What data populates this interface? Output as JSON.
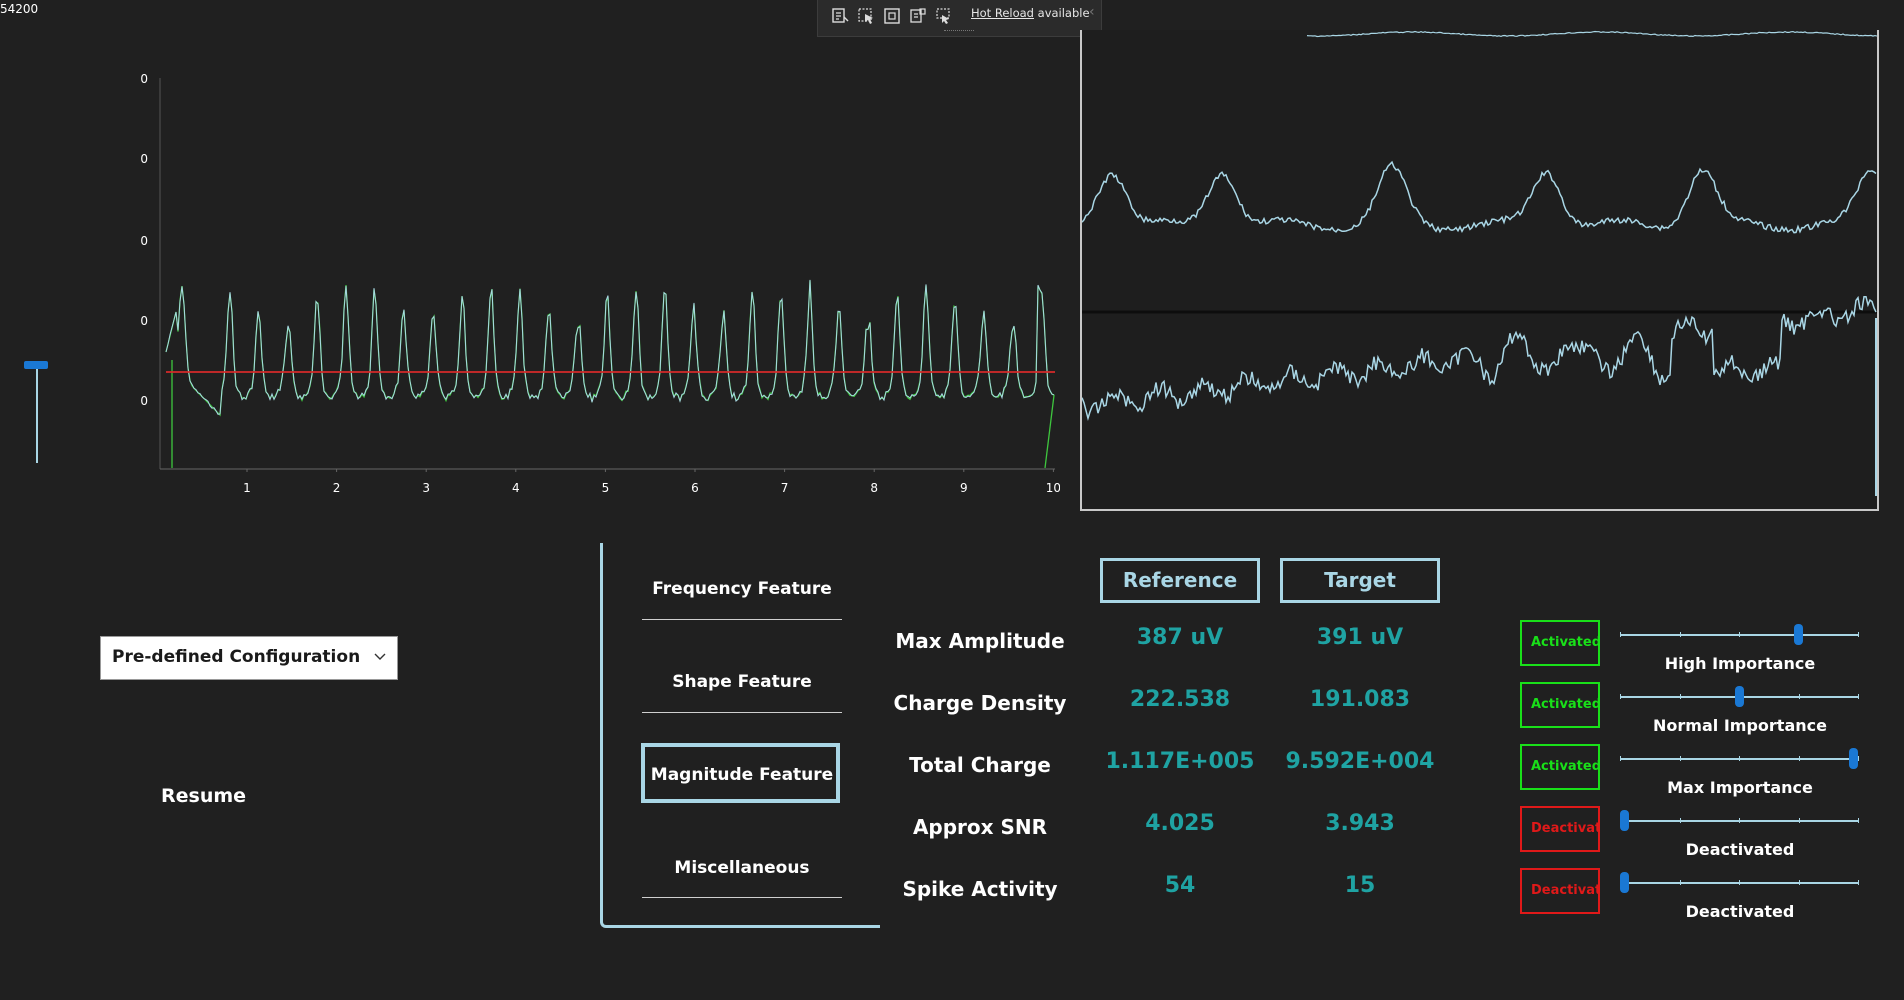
{
  "counter": "54200",
  "toolbar": {
    "hot_reload_link": "Hot Reload",
    "hot_reload_status": "available",
    "collapse_glyph": "‹"
  },
  "chart": {
    "y_ticks": [
      "0",
      "0",
      "0",
      "0",
      "0"
    ],
    "x_ticks": [
      "1",
      "2",
      "3",
      "4",
      "5",
      "6",
      "7",
      "8",
      "9",
      "10"
    ],
    "signal_color": "#3ec63e",
    "trace_color": "#a9d6e5",
    "baseline_color": "#d42a2a"
  },
  "config_dropdown": {
    "selected": "Pre-defined Configuration",
    "icon": "chevron-down-icon"
  },
  "resume_label": "Resume",
  "features": {
    "items": [
      "Frequency Feature",
      "Shape Feature",
      "Magnitude Feature",
      "Miscellaneous"
    ],
    "selected": "Magnitude Feature"
  },
  "columns": {
    "reference": "Reference",
    "target": "Target"
  },
  "metrics": [
    {
      "label": "Max Amplitude",
      "reference": "387 uV",
      "target": "391 uV",
      "state": "Activated",
      "importance": "High Importance",
      "level": 0.76
    },
    {
      "label": "Charge Density",
      "reference": "222.538",
      "target": "191.083",
      "state": "Activated",
      "importance": "Normal Importance",
      "level": 0.5
    },
    {
      "label": "Total Charge",
      "reference": "1.117E+005",
      "target": "9.592E+004",
      "state": "Activated",
      "importance": "Max Importance",
      "level": 1.0
    },
    {
      "label": "Approx SNR",
      "reference": "4.025",
      "target": "3.943",
      "state": "Deactivated",
      "importance": "Deactivated",
      "level": 0.0
    },
    {
      "label": "Spike Activity",
      "reference": "54",
      "target": "15",
      "state": "Deactivated",
      "importance": "Deactivated",
      "level": 0.0
    }
  ],
  "colors": {
    "background": "#202020",
    "accent": "#a9d6e5",
    "value_teal": "#1fa3a3",
    "active_green": "#19e019",
    "inactive_red": "#e01919",
    "slider_blue": "#1a78d4"
  }
}
